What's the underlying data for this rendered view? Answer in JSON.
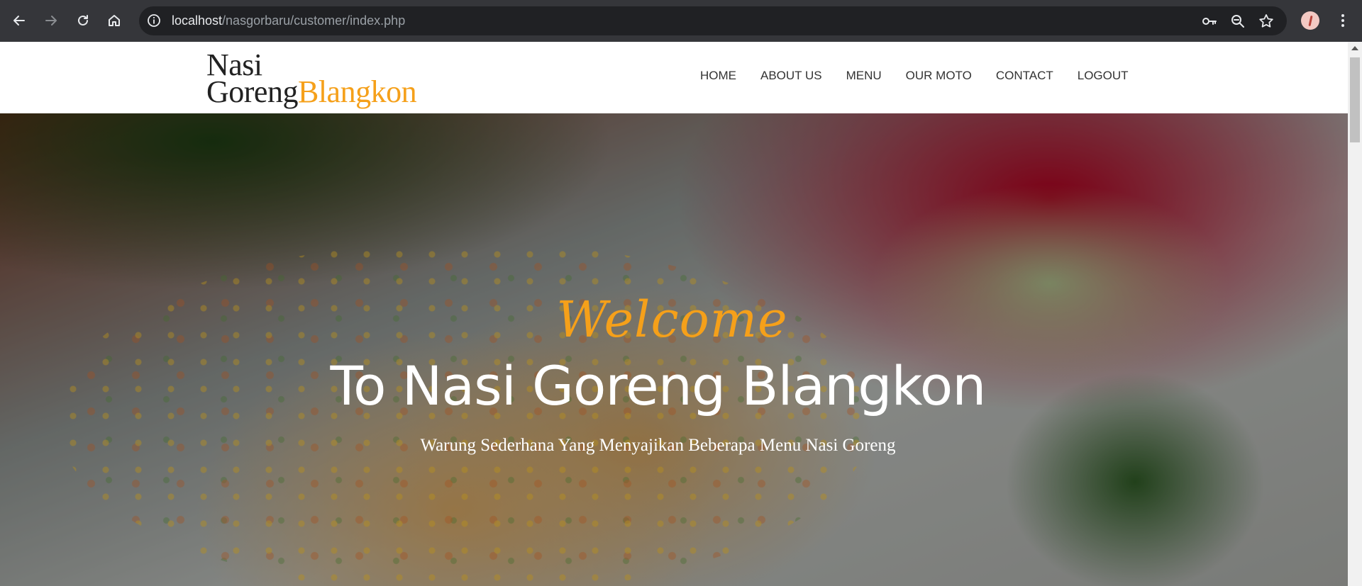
{
  "browser": {
    "url_host": "localhost",
    "url_path": "/nasgorbaru/customer/index.php",
    "icons": [
      "back-arrow-icon",
      "forward-arrow-icon",
      "reload-icon",
      "home-icon",
      "site-info-icon",
      "password-key-icon",
      "zoom-icon",
      "bookmark-star-icon",
      "profile-avatar",
      "kebab-menu-icon"
    ]
  },
  "site": {
    "logo_line1": "Nasi",
    "logo_line2_a": "Goreng",
    "logo_line2_b": "Blangkon",
    "accent_color": "#f5a01a",
    "nav": [
      {
        "label": "HOME"
      },
      {
        "label": "ABOUT US"
      },
      {
        "label": "MENU"
      },
      {
        "label": "OUR MOTO"
      },
      {
        "label": "CONTACT"
      },
      {
        "label": "LOGOUT"
      }
    ]
  },
  "hero": {
    "welcome": "Welcome",
    "headline": "To Nasi Goreng Blangkon",
    "subline": "Warung Sederhana Yang Menyajikan Beberapa Menu Nasi Goreng"
  }
}
